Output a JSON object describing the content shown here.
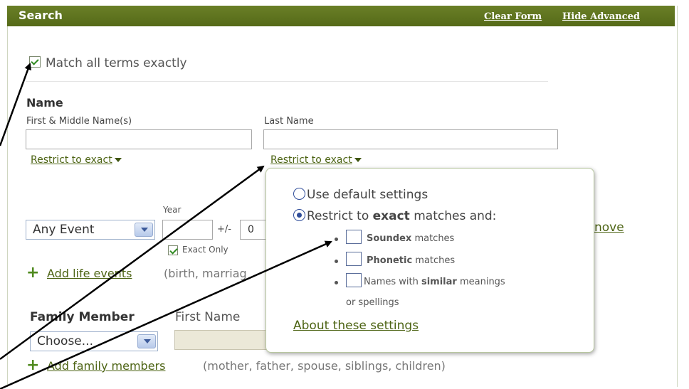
{
  "header": {
    "title": "Search",
    "clear_form": "Clear Form",
    "hide_advanced": "Hide Advanced"
  },
  "match_all": {
    "label": "Match all terms exactly",
    "checked": true
  },
  "name_section": {
    "heading": "Name",
    "first_label": "First & Middle Name(s)",
    "last_label": "Last Name",
    "first_value": "",
    "last_value": "",
    "restrict_first": "Restrict to exact",
    "restrict_last": "Restrict to exact"
  },
  "event_section": {
    "year_label": "Year",
    "event_select": "Any Event",
    "year_value": "",
    "plusminus": "+/-",
    "range_value": "0",
    "exact_only": "Exact Only",
    "exact_only_checked": true,
    "remove_partial": "nove",
    "add_life_events_link": "Add life events",
    "add_life_events_hint": "(birth, marriag"
  },
  "family_section": {
    "heading": "Family Member",
    "first_name_label": "First Name",
    "member_select": "Choose...",
    "add_members_link": "Add family members",
    "add_members_hint": "(mother, father, spouse, siblings, children)"
  },
  "popup": {
    "option_default": "Use default settings",
    "option_restrict_prefix": "Restrict to ",
    "option_restrict_bold": "exact",
    "option_restrict_suffix": " matches and:",
    "soundex_bold": "Soundex",
    "soundex_rest": " matches",
    "phonetic_bold": "Phonetic",
    "phonetic_rest": " matches",
    "similar_prefix": "Names with ",
    "similar_bold": "similar",
    "similar_rest": " meanings",
    "similar_line2": "or spellings",
    "about_link": "About these settings",
    "selected_option": "restrict"
  },
  "colors": {
    "header_bg": "#5a6f1c",
    "link_green": "#4d6414",
    "radio_blue": "#2f4d9a"
  }
}
